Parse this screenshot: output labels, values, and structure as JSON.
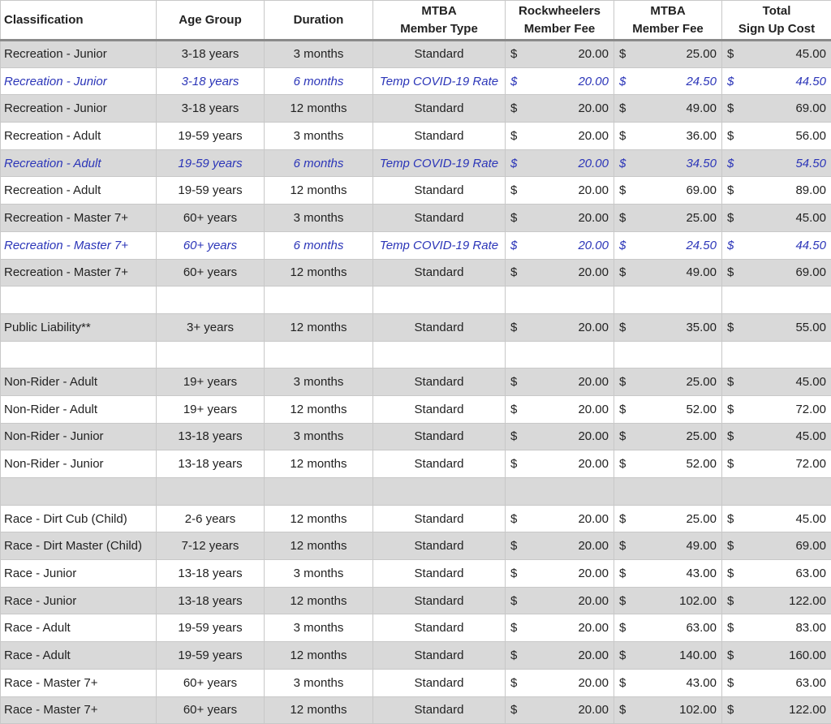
{
  "headers": [
    [
      "Classification"
    ],
    [
      "Age Group"
    ],
    [
      "Duration"
    ],
    [
      "MTBA",
      "Member Type"
    ],
    [
      "Rockwheelers",
      "Member Fee"
    ],
    [
      "MTBA",
      "Member Fee"
    ],
    [
      "Total",
      "Sign Up Cost"
    ]
  ],
  "currency_symbol": "$",
  "rows": [
    {
      "style": "shade",
      "cells": [
        "Recreation - Junior",
        "3-18 years",
        "3 months",
        "Standard",
        "20.00",
        "25.00",
        "45.00"
      ]
    },
    {
      "style": "covid",
      "cells": [
        "Recreation - Junior",
        "3-18 years",
        "6 months",
        "Temp COVID-19 Rate",
        "20.00",
        "24.50",
        "44.50"
      ]
    },
    {
      "style": "shade",
      "cells": [
        "Recreation - Junior",
        "3-18 years",
        "12 months",
        "Standard",
        "20.00",
        "49.00",
        "69.00"
      ]
    },
    {
      "style": "plain",
      "cells": [
        "Recreation - Adult",
        "19-59 years",
        "3 months",
        "Standard",
        "20.00",
        "36.00",
        "56.00"
      ]
    },
    {
      "style": "shade covid",
      "cells": [
        "Recreation - Adult",
        "19-59 years",
        "6 months",
        "Temp COVID-19 Rate",
        "20.00",
        "34.50",
        "54.50"
      ]
    },
    {
      "style": "plain",
      "cells": [
        "Recreation - Adult",
        "19-59 years",
        "12 months",
        "Standard",
        "20.00",
        "69.00",
        "89.00"
      ]
    },
    {
      "style": "shade",
      "cells": [
        "Recreation - Master 7+",
        "60+ years",
        "3 months",
        "Standard",
        "20.00",
        "25.00",
        "45.00"
      ]
    },
    {
      "style": "covid",
      "cells": [
        "Recreation - Master 7+",
        "60+ years",
        "6 months",
        "Temp COVID-19 Rate",
        "20.00",
        "24.50",
        "44.50"
      ]
    },
    {
      "style": "shade",
      "cells": [
        "Recreation - Master 7+",
        "60+ years",
        "12 months",
        "Standard",
        "20.00",
        "49.00",
        "69.00"
      ]
    },
    {
      "style": "plain",
      "blank": true
    },
    {
      "style": "shade",
      "cells": [
        "Public Liability**",
        "3+ years",
        "12 months",
        "Standard",
        "20.00",
        "35.00",
        "55.00"
      ]
    },
    {
      "style": "plain",
      "blank": true
    },
    {
      "style": "shade",
      "cells": [
        "Non-Rider - Adult",
        "19+ years",
        "3 months",
        "Standard",
        "20.00",
        "25.00",
        "45.00"
      ]
    },
    {
      "style": "plain",
      "cells": [
        "Non-Rider - Adult",
        "19+ years",
        "12 months",
        "Standard",
        "20.00",
        "52.00",
        "72.00"
      ]
    },
    {
      "style": "shade",
      "cells": [
        "Non-Rider - Junior",
        "13-18 years",
        "3 months",
        "Standard",
        "20.00",
        "25.00",
        "45.00"
      ]
    },
    {
      "style": "plain",
      "cells": [
        "Non-Rider - Junior",
        "13-18 years",
        "12 months",
        "Standard",
        "20.00",
        "52.00",
        "72.00"
      ]
    },
    {
      "style": "shade",
      "blank": true
    },
    {
      "style": "plain",
      "cells": [
        "Race - Dirt Cub (Child)",
        "2-6 years",
        "12 months",
        "Standard",
        "20.00",
        "25.00",
        "45.00"
      ]
    },
    {
      "style": "shade",
      "cells": [
        "Race - Dirt Master (Child)",
        "7-12 years",
        "12 months",
        "Standard",
        "20.00",
        "49.00",
        "69.00"
      ]
    },
    {
      "style": "plain",
      "cells": [
        "Race - Junior",
        "13-18 years",
        "3 months",
        "Standard",
        "20.00",
        "43.00",
        "63.00"
      ]
    },
    {
      "style": "shade",
      "cells": [
        "Race - Junior",
        "13-18 years",
        "12 months",
        "Standard",
        "20.00",
        "102.00",
        "122.00"
      ]
    },
    {
      "style": "plain",
      "cells": [
        "Race - Adult",
        "19-59 years",
        "3 months",
        "Standard",
        "20.00",
        "63.00",
        "83.00"
      ]
    },
    {
      "style": "shade",
      "cells": [
        "Race - Adult",
        "19-59 years",
        "12 months",
        "Standard",
        "20.00",
        "140.00",
        "160.00"
      ]
    },
    {
      "style": "plain",
      "cells": [
        "Race - Master 7+",
        "60+ years",
        "3 months",
        "Standard",
        "20.00",
        "43.00",
        "63.00"
      ]
    },
    {
      "style": "shade",
      "cells": [
        "Race - Master 7+",
        "60+ years",
        "12 months",
        "Standard",
        "20.00",
        "102.00",
        "122.00"
      ]
    }
  ],
  "colors": {
    "shade": "#d9d9d9",
    "covid_text": "#2b35b8",
    "grid": "#c8c8c8",
    "header_rule": "#8a8a8a"
  }
}
